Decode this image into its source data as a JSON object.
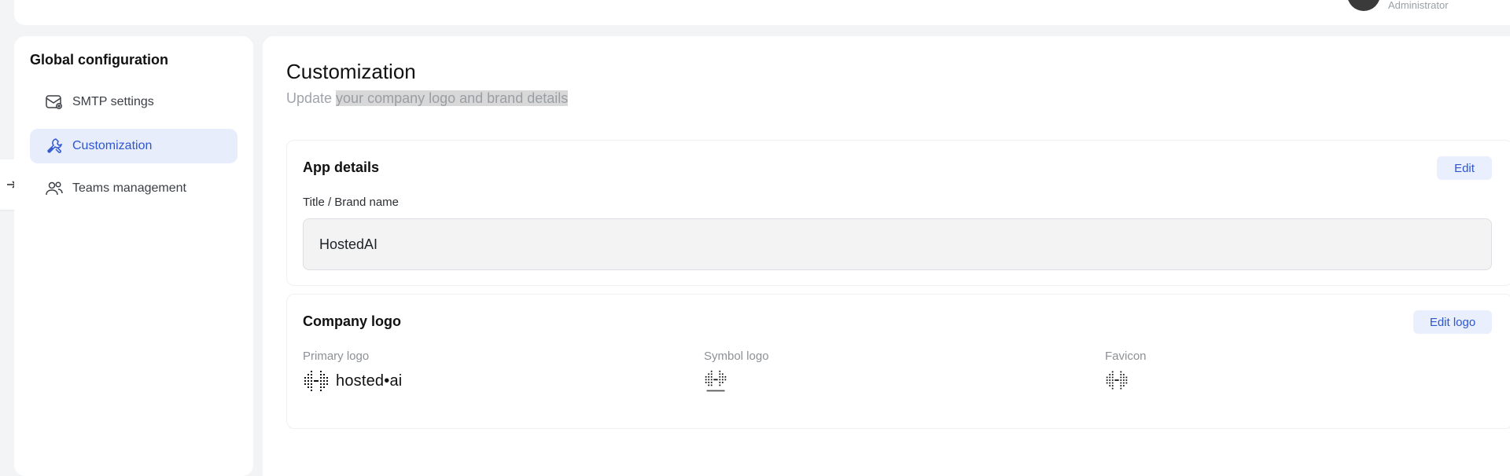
{
  "header": {
    "user_role": "Administrator"
  },
  "sidebar": {
    "title": "Global configuration",
    "items": [
      {
        "label": "SMTP settings",
        "icon": "mail-settings-icon",
        "active": false
      },
      {
        "label": "Customization",
        "icon": "wrench-brush-icon",
        "active": true
      },
      {
        "label": "Teams management",
        "icon": "users-icon",
        "active": false
      }
    ]
  },
  "page": {
    "title": "Customization",
    "subtitle_prefix": "Update ",
    "subtitle_selected": "your company logo and brand details"
  },
  "app_details": {
    "title": "App details",
    "edit_label": "Edit",
    "field_label": "Title / Brand name",
    "field_value": "HostedAI"
  },
  "company_logo": {
    "title": "Company logo",
    "edit_label": "Edit logo",
    "primary_label": "Primary logo",
    "primary_wordmark": "hosted•ai",
    "symbol_label": "Symbol logo",
    "favicon_label": "Favicon"
  },
  "colors": {
    "accent": "#2e56d1",
    "active_bg": "#e8edfc",
    "page_bg": "#f3f4f6"
  }
}
